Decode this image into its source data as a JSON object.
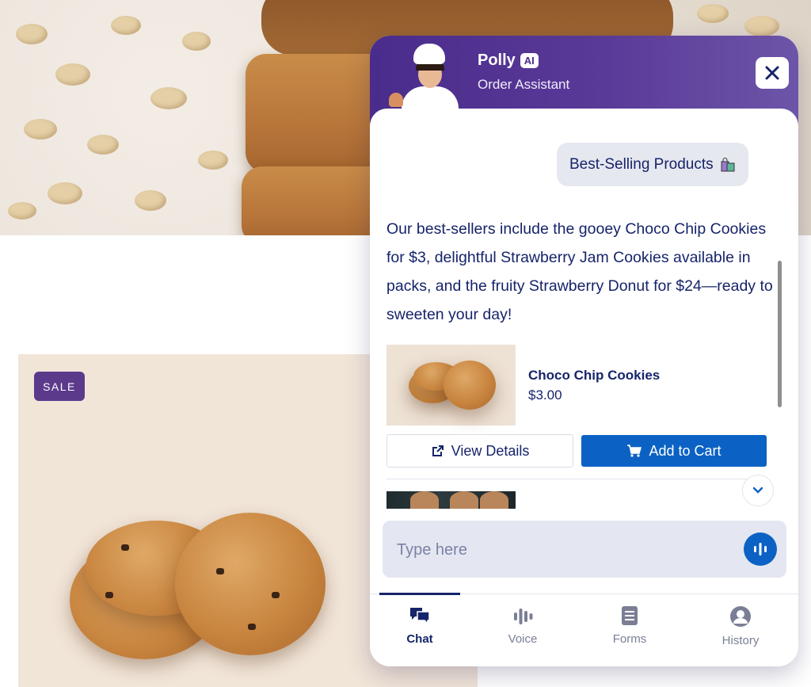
{
  "product_card": {
    "badge": "SALE"
  },
  "assistant": {
    "name": "Polly",
    "badge": "AI",
    "role": "Order Assistant"
  },
  "chat": {
    "user_message": "Best-Selling Products",
    "bot_message": "Our best-sellers include the gooey Choco Chip Cookies for $3, delightful Strawberry Jam Cookies available in packs, and the fruity Strawberry Donut for $24—ready to sweeten your day!",
    "product": {
      "name": "Choco Chip Cookies",
      "price": "$3.00",
      "view_label": "View Details",
      "cart_label": "Add to Cart"
    }
  },
  "input": {
    "placeholder": "Type here"
  },
  "tabs": [
    {
      "label": "Chat",
      "icon": "chat-icon",
      "active": true
    },
    {
      "label": "Voice",
      "icon": "voice-bars-icon",
      "active": false
    },
    {
      "label": "Forms",
      "icon": "forms-icon",
      "active": false
    },
    {
      "label": "History",
      "icon": "user-circle-icon",
      "active": false
    }
  ],
  "colors": {
    "header_purple": "#4a2c8c",
    "primary_blue": "#0b62c4",
    "text_navy": "#16246a",
    "sale_badge": "#5b3a8c"
  }
}
